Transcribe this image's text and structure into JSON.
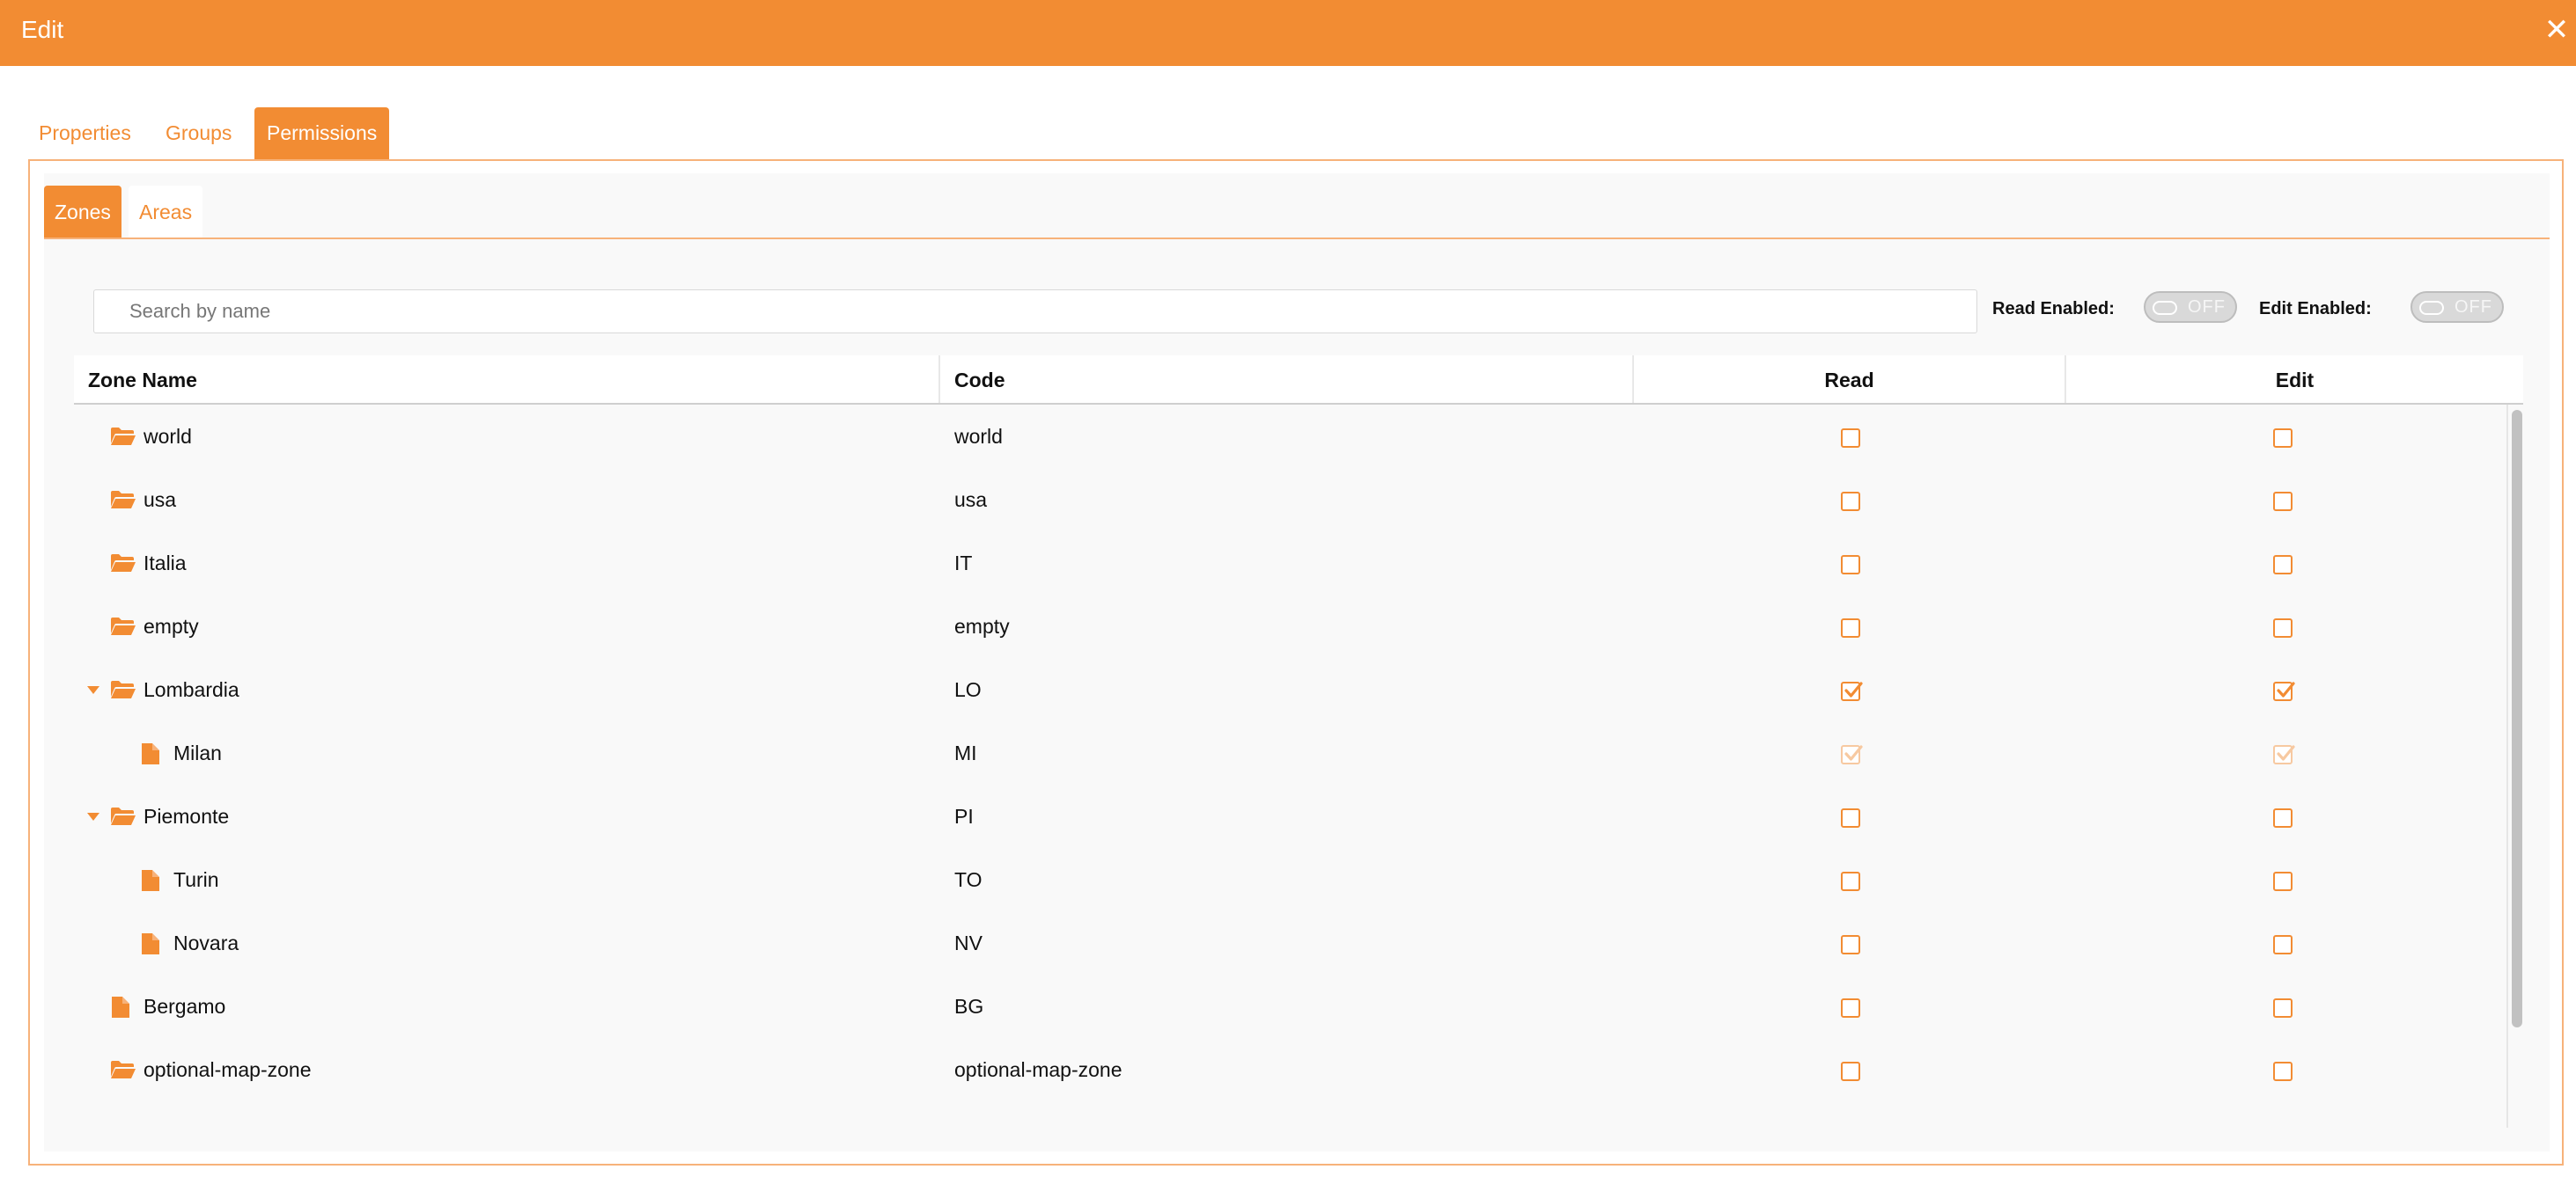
{
  "window": {
    "title": "Edit",
    "close_icon": "close-icon"
  },
  "tabs": [
    {
      "label": "Properties",
      "active": false
    },
    {
      "label": "Groups",
      "active": false
    },
    {
      "label": "Permissions",
      "active": true
    }
  ],
  "subtabs": [
    {
      "label": "Zones",
      "active": true
    },
    {
      "label": "Areas",
      "active": false
    }
  ],
  "search": {
    "placeholder": "Search by name",
    "value": ""
  },
  "toggles": {
    "read": {
      "label": "Read Enabled:",
      "state": "OFF"
    },
    "edit": {
      "label": "Edit Enabled:",
      "state": "OFF"
    }
  },
  "table": {
    "columns": [
      "Zone Name",
      "Code",
      "Read",
      "Edit"
    ],
    "rows": [
      {
        "name": "world",
        "code": "world",
        "icon": "folder-open-icon",
        "level": 0,
        "expandable": false,
        "read": false,
        "edit": false,
        "disabled": false
      },
      {
        "name": "usa",
        "code": "usa",
        "icon": "folder-open-icon",
        "level": 0,
        "expandable": false,
        "read": false,
        "edit": false,
        "disabled": false
      },
      {
        "name": "Italia",
        "code": "IT",
        "icon": "folder-open-icon",
        "level": 0,
        "expandable": false,
        "read": false,
        "edit": false,
        "disabled": false
      },
      {
        "name": "empty",
        "code": "empty",
        "icon": "folder-open-icon",
        "level": 0,
        "expandable": false,
        "read": false,
        "edit": false,
        "disabled": false
      },
      {
        "name": "Lombardia",
        "code": "LO",
        "icon": "folder-open-icon",
        "level": 0,
        "expandable": true,
        "read": true,
        "edit": true,
        "disabled": false
      },
      {
        "name": "Milan",
        "code": "MI",
        "icon": "file-icon",
        "level": 1,
        "expandable": false,
        "read": true,
        "edit": true,
        "disabled": true
      },
      {
        "name": "Piemonte",
        "code": "PI",
        "icon": "folder-open-icon",
        "level": 0,
        "expandable": true,
        "read": false,
        "edit": false,
        "disabled": false
      },
      {
        "name": "Turin",
        "code": "TO",
        "icon": "file-icon",
        "level": 1,
        "expandable": false,
        "read": false,
        "edit": false,
        "disabled": false
      },
      {
        "name": "Novara",
        "code": "NV",
        "icon": "file-icon",
        "level": 1,
        "expandable": false,
        "read": false,
        "edit": false,
        "disabled": false
      },
      {
        "name": "Bergamo",
        "code": "BG",
        "icon": "file-icon",
        "level": 0,
        "expandable": false,
        "read": false,
        "edit": false,
        "disabled": false
      },
      {
        "name": "optional-map-zone",
        "code": "optional-map-zone",
        "icon": "folder-open-icon",
        "level": 0,
        "expandable": false,
        "read": false,
        "edit": false,
        "disabled": false
      }
    ]
  },
  "colors": {
    "accent": "#f28c33",
    "accent_light": "#f7b27a",
    "panel_bg": "#f9f9f9"
  }
}
